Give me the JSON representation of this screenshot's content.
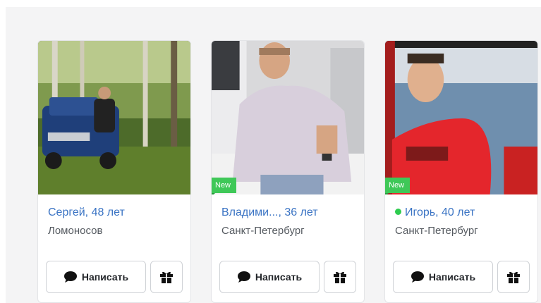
{
  "profiles": [
    {
      "name": "Сергей, 48 лет",
      "city": "Ломоносов",
      "badge": "",
      "online": false,
      "write_label": "Написать",
      "photo_icon": "man-with-jeep-forest"
    },
    {
      "name": "Владими..., 36 лет",
      "city": "Санкт-Петербург",
      "badge": "New",
      "online": false,
      "write_label": "Написать",
      "photo_icon": "man-sitting-white-shirt"
    },
    {
      "name": "Игорь, 40 лет",
      "city": "Санкт-Петербург",
      "badge": "New",
      "online": true,
      "write_label": "Написать",
      "photo_icon": "man-red-shirt-sea"
    }
  ],
  "colors": {
    "name_link": "#3b74c4",
    "new_badge": "#3fc858",
    "online_dot": "#2ecc4f"
  },
  "icons": {
    "write_button": "speech-bubble-icon",
    "gift_button": "gift-icon"
  }
}
